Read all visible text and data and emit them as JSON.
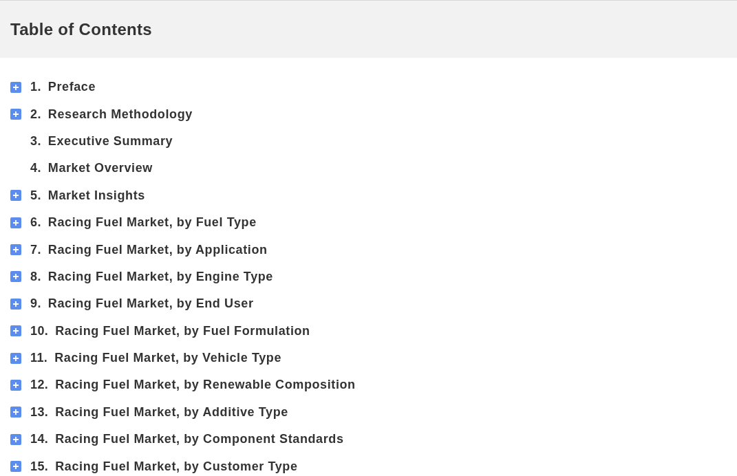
{
  "header": {
    "title": "Table of Contents"
  },
  "items": [
    {
      "kind": "expandable",
      "number": "1.",
      "title": "Preface"
    },
    {
      "kind": "expandable",
      "number": "2.",
      "title": "Research Methodology"
    },
    {
      "kind": "plain",
      "number": "3.",
      "title": "Executive Summary"
    },
    {
      "kind": "plain",
      "number": "4.",
      "title": "Market Overview"
    },
    {
      "kind": "expandable",
      "number": "5.",
      "title": "Market Insights"
    },
    {
      "kind": "expandable",
      "number": "6.",
      "title": "Racing Fuel Market, by Fuel Type"
    },
    {
      "kind": "expandable",
      "number": "7.",
      "title": "Racing Fuel Market, by Application"
    },
    {
      "kind": "expandable",
      "number": "8.",
      "title": "Racing Fuel Market, by Engine Type"
    },
    {
      "kind": "expandable",
      "number": "9.",
      "title": "Racing Fuel Market, by End User"
    },
    {
      "kind": "expandable",
      "number": "10.",
      "title": "Racing Fuel Market, by Fuel Formulation"
    },
    {
      "kind": "expandable",
      "number": "11.",
      "title": "Racing Fuel Market, by Vehicle Type"
    },
    {
      "kind": "expandable",
      "number": "12.",
      "title": "Racing Fuel Market, by Renewable Composition"
    },
    {
      "kind": "expandable",
      "number": "13.",
      "title": "Racing Fuel Market, by Additive Type"
    },
    {
      "kind": "expandable",
      "number": "14.",
      "title": "Racing Fuel Market, by Component Standards"
    },
    {
      "kind": "expandable",
      "number": "15.",
      "title": "Racing Fuel Market, by Customer Type"
    }
  ]
}
